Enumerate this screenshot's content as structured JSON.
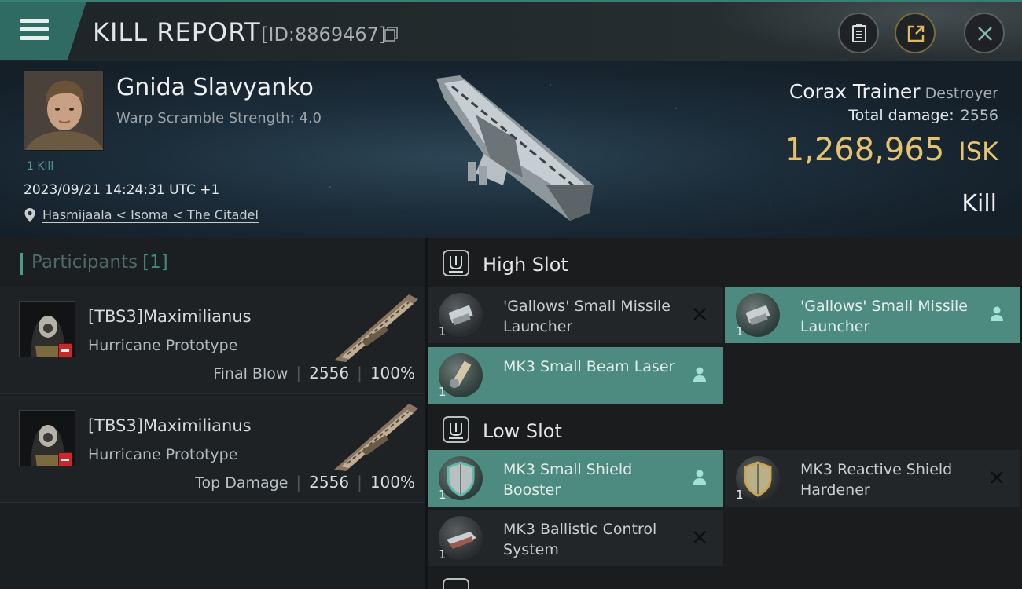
{
  "header": {
    "title": "KILL REPORT",
    "id_text": "[ID:8869467]"
  },
  "victim": {
    "name": "Gnida Slavyanko",
    "subtitle": "Warp Scramble Strength: 4.0",
    "kills_label": "1 Kill",
    "datetime": "2023/09/21 14:24:31 UTC +1",
    "location": "Hasmijaala < Isoma < The Citadel",
    "ship_name": "Corax Trainer",
    "ship_class": "Destroyer",
    "damage_label": "Total damage:",
    "damage_value": "2556",
    "isk_value": "1,268,965",
    "isk_unit": "ISK",
    "result": "Kill"
  },
  "participants": {
    "title": "Participants",
    "count": "[1]",
    "rows": [
      {
        "name": "[TBS3]Maximilianus",
        "ship": "Hurricane Prototype",
        "role": "Final Blow",
        "damage": "2556",
        "percent": "100%"
      },
      {
        "name": "[TBS3]Maximilianus",
        "ship": "Hurricane Prototype",
        "role": "Top Damage",
        "damage": "2556",
        "percent": "100%"
      }
    ]
  },
  "fitting": {
    "high_slot": {
      "title": "High Slot",
      "modules": [
        {
          "name": "'Gallows' Small Missile Launcher",
          "qty": "1",
          "status": "dropped",
          "icon": "missile-launcher-icon"
        },
        {
          "name": "'Gallows' Small Missile Launcher",
          "qty": "1",
          "status": "destroyed",
          "icon": "missile-launcher-icon"
        },
        {
          "name": "MK3 Small Beam Laser",
          "qty": "1",
          "status": "destroyed",
          "icon": "beam-laser-icon"
        }
      ]
    },
    "low_slot": {
      "title": "Low Slot",
      "modules": [
        {
          "name": "MK3 Small Shield Booster",
          "qty": "1",
          "status": "destroyed",
          "icon": "shield-booster-icon"
        },
        {
          "name": "MK3 Reactive Shield Hardener",
          "qty": "1",
          "status": "dropped",
          "icon": "shield-hardener-icon"
        },
        {
          "name": "MK3 Ballistic Control System",
          "qty": "1",
          "status": "dropped",
          "icon": "ballistic-control-icon"
        }
      ]
    }
  },
  "colors": {
    "accent_teal": "#4d8b80",
    "isk_gold": "#e7c26d",
    "corp_red": "#c8272c"
  }
}
